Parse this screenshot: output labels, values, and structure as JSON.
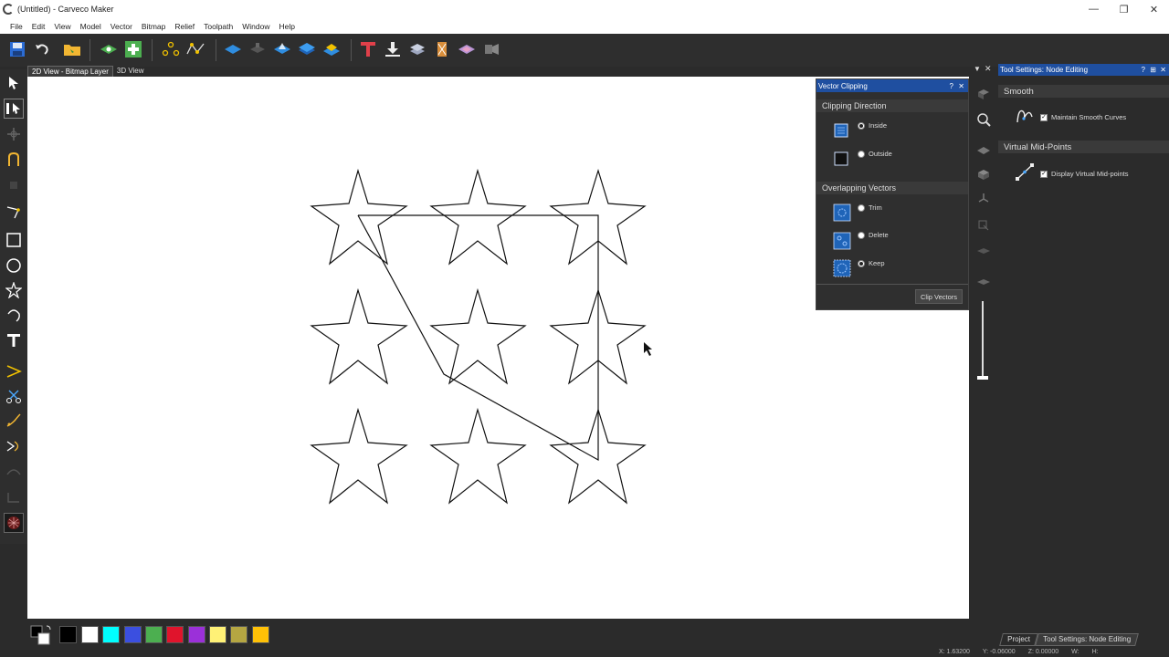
{
  "window": {
    "title": "(Untitled) - Carveco Maker",
    "minimize": "—",
    "maximize": "❐",
    "close": "✕"
  },
  "menu": [
    "File",
    "Edit",
    "View",
    "Model",
    "Vector",
    "Bitmap",
    "Relief",
    "Toolpath",
    "Window",
    "Help"
  ],
  "view_tabs": [
    {
      "label": "2D View - Bitmap Layer",
      "active": true
    },
    {
      "label": "3D View",
      "active": false
    }
  ],
  "clipping_panel": {
    "title": "Vector Clipping",
    "help": "?",
    "close": "✕",
    "direction_title": "Clipping Direction",
    "direction_options": [
      {
        "label": "Inside",
        "selected": true
      },
      {
        "label": "Outside",
        "selected": false
      }
    ],
    "overlap_title": "Overlapping Vectors",
    "overlap_options": [
      {
        "label": "Trim",
        "selected": false
      },
      {
        "label": "Delete",
        "selected": false
      },
      {
        "label": "Keep",
        "selected": true
      }
    ],
    "button": "Clip Vectors"
  },
  "tool_settings": {
    "title": "Tool Settings: Node Editing",
    "help": "?",
    "pin": "⊞",
    "close": "✕",
    "smooth_title": "Smooth",
    "smooth_option": {
      "label": "Maintain Smooth Curves",
      "checked": true
    },
    "midpoints_title": "Virtual Mid-Points",
    "midpoints_option": {
      "label": "Display Virtual Mid-points",
      "checked": true
    }
  },
  "palette": [
    "#000000",
    "#ffffff",
    "#00ffff",
    "#3b4fe0",
    "#4caf50",
    "#e0142c",
    "#9b30d9",
    "#fff176",
    "#b5a642",
    "#ffc107"
  ],
  "bottom_tabs": [
    {
      "label": "Project",
      "active": false
    },
    {
      "label": "Tool Settings: Node Editing",
      "active": true
    }
  ],
  "status": {
    "x": "X: 1.63200",
    "y": "Y: -0.06000",
    "z": "Z: 0.00000",
    "w": "W:",
    "h": "H:"
  }
}
